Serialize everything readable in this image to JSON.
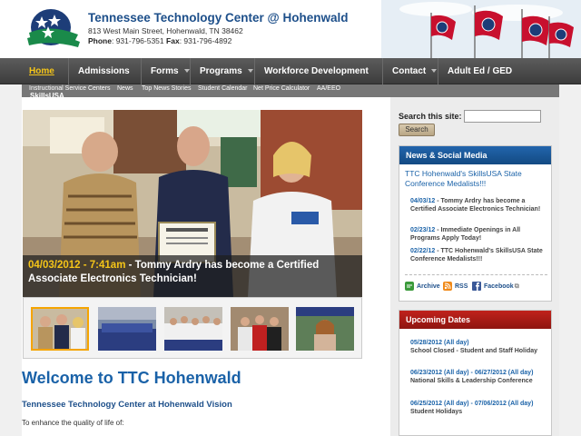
{
  "header": {
    "title": "Tennessee Technology Center @ Hohenwald",
    "address": "813 West Main Street, Hohenwald, TN 38462",
    "phone_label": "Phone",
    "phone": ": 931-796-5351",
    "fax_label": "Fax",
    "fax": ": 931-796-4892"
  },
  "nav": {
    "items": [
      "Home",
      "Admissions",
      "Forms",
      "Programs",
      "Workforce Development",
      "Contact",
      "Adult Ed / GED"
    ]
  },
  "subnav": {
    "items": [
      "Instructional Service Centers",
      "News",
      "Top News Stories",
      "Student Calendar",
      "Net Price Calculator",
      "AA/EEO"
    ],
    "overflow_label": "SkillsUSA"
  },
  "hero": {
    "date": "04/03/2012 - 7:41am",
    "separator": " - ",
    "headline": "Tommy Ardry has become a Certified Associate Electronics Technician!"
  },
  "main": {
    "welcome": "Welcome to TTC Hohenwald",
    "vision": "Tennessee Technology Center at Hohenwald Vision",
    "enhance": "To enhance the quality of life of:"
  },
  "search": {
    "label": "Search this site:",
    "value": "",
    "button": "Search"
  },
  "news": {
    "heading": "News & Social Media",
    "headline": "TTC Hohenwald's SkillsUSA State Conference Medalists!!!",
    "items": [
      {
        "date": "04/03/12",
        "text": " - Tommy Ardry has become a Certified Associate Electronics Technician!"
      },
      {
        "date": "02/23/12",
        "text": " - Immediate Openings in All Programs Apply Today!"
      },
      {
        "date": "02/22/12",
        "text": " - TTC Hohenwald's SkillsUSA State Conference Medalists!!!"
      }
    ],
    "social": [
      "Archive",
      "RSS",
      "Facebook"
    ]
  },
  "events": {
    "heading": "Upcoming Dates",
    "items": [
      {
        "date": "05/28/2012 (All day)",
        "text": "School Closed - Student and Staff Holiday"
      },
      {
        "date": "06/23/2012 (All day) - 06/27/2012 (All day)",
        "text": "National Skills & Leadership Conference"
      },
      {
        "date": "06/25/2012 (All day) - 07/06/2012 (All day)",
        "text": "Student Holidays"
      }
    ]
  },
  "colors": {
    "accent_blue": "#1a62a8",
    "title_blue": "#1d4f8a",
    "nav_bg": "#4a4a4a",
    "highlight_yellow": "#f5c518",
    "events_red": "#b01c16"
  }
}
